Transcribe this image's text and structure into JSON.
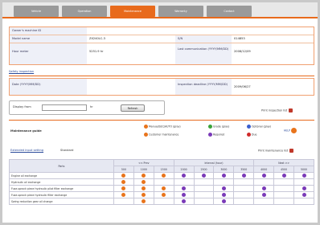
{
  "tabs": [
    {
      "label": "Vehicle",
      "active": false
    },
    {
      "label": "Operation",
      "active": false
    },
    {
      "label": "Maintenance",
      "active": true
    },
    {
      "label": "Warranty",
      "active": false
    },
    {
      "label": "Contact",
      "active": false
    }
  ],
  "info": {
    "owner_label": "Owner's machine ID",
    "owner_value": "",
    "model_label": "Model name",
    "model_value": "ZX240LC-3",
    "serial_label": "S/N",
    "serial_value": "014853",
    "hour_label": "Hour meter",
    "hour_value": "5251.9 hr",
    "comm_label": "Last communication (YYYY/MM/DD)",
    "comm_value": "2008/12/09"
  },
  "inspection": {
    "title": "Safety inspection",
    "date_label": "Date (YYYY/MM/DD)",
    "date_value": "",
    "deadline_label": "Inspection deadline (YYYY/MM/DD)",
    "deadline_value": "2009/06/27"
  },
  "display": {
    "label": "Display from",
    "input_value": "",
    "unit": "hr",
    "button": "Refresh",
    "print1": "Print inspection list"
  },
  "legend": {
    "title": "Maintenance guide",
    "items": [
      {
        "label": "Manual/SEC/AUTO (gray)",
        "color": "orange"
      },
      {
        "label": "Grade (gray)",
        "color": "green"
      },
      {
        "label": "Optional (gray)",
        "color": "blue"
      },
      {
        "label": "Customer maintenance",
        "color": "orange"
      },
      {
        "label": "Required",
        "color": "purple"
      },
      {
        "label": "Due",
        "color": "red"
      }
    ],
    "help": "HELP"
  },
  "subhead": {
    "link": "Extended input setting",
    "link2": "Standard",
    "print2": "Print maintenance list"
  },
  "table": {
    "col_header": "Parts",
    "group1": "<< Prev",
    "group2": "Interval (hour)",
    "group3": "Next >>",
    "hours": [
      "500",
      "1000",
      "1500",
      "2000",
      "2500",
      "3000",
      "3500",
      "4000",
      "4500",
      "5000"
    ],
    "rows": [
      {
        "name": "Engine oil exchange",
        "marks": [
          "orange",
          "orange",
          "orange",
          "purple",
          "purple",
          "purple",
          "purple",
          "purple",
          "purple",
          "purple"
        ]
      },
      {
        "name": "Hydraulic oil exchange",
        "marks": [
          "orange",
          "orange",
          "",
          "",
          "",
          "",
          "",
          "",
          "",
          ""
        ]
      },
      {
        "name": "Fuse-sprock piece hydraulic pilot filter exchange",
        "marks": [
          "orange",
          "orange",
          "orange",
          "purple",
          "",
          "purple",
          "",
          "purple",
          "",
          "purple"
        ]
      },
      {
        "name": "Fuse-sprock piece hydraulic filter exchange",
        "marks": [
          "orange",
          "orange",
          "orange",
          "purple",
          "",
          "purple",
          "",
          "purple",
          "",
          "purple"
        ]
      },
      {
        "name": "Swing reduction gear oil change",
        "marks": [
          "",
          "orange",
          "",
          "purple",
          "",
          "purple",
          "",
          "",
          "",
          ""
        ]
      }
    ]
  }
}
